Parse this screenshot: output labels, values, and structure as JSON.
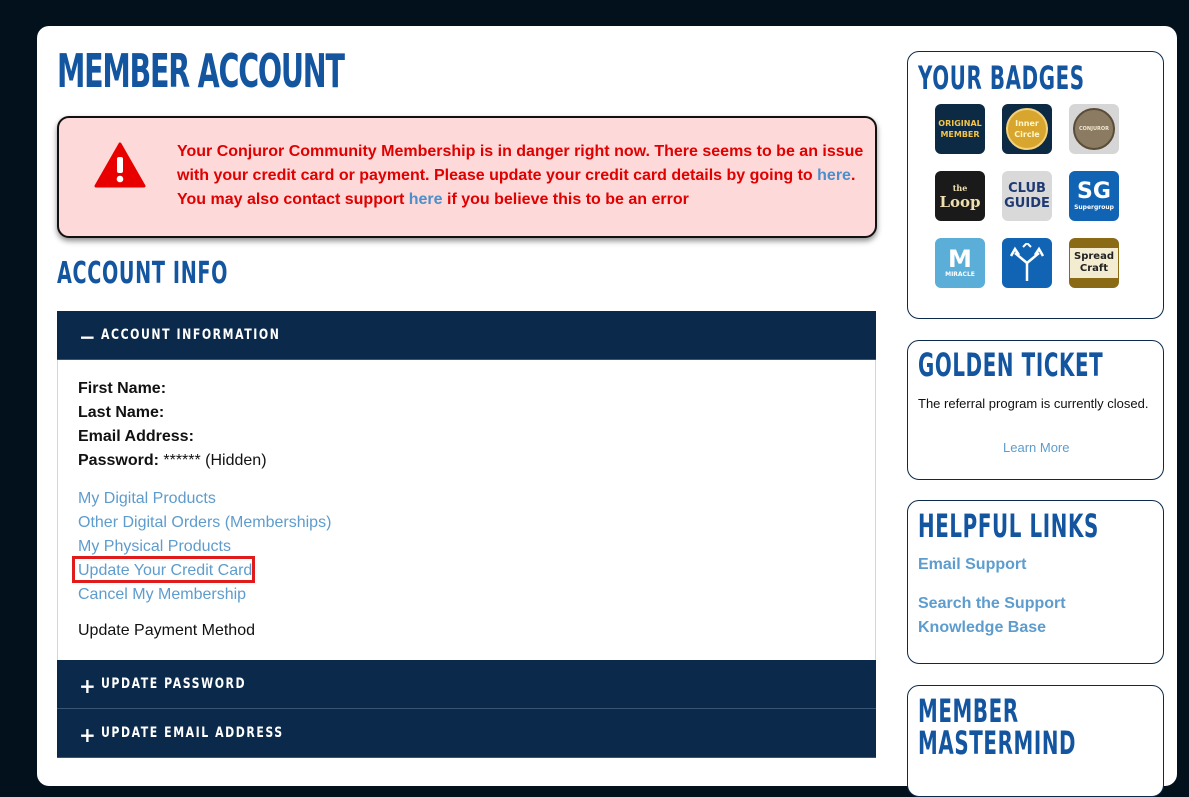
{
  "page": {
    "title": "MEMBER ACCOUNT"
  },
  "alert": {
    "line1": "Your Conjuror Community Membership is in danger right now. There seems to be an issue",
    "line2a": "with your credit card or payment. Please update your credit card details by going to ",
    "line2_link": "here",
    "line2b": ".",
    "line3a": "You may also contact support ",
    "line3_link": "here",
    "line3b": " if you believe this to be an error"
  },
  "account_info": {
    "heading": "ACCOUNT INFO",
    "section_label": "ACCOUNT INFORMATION",
    "fields": {
      "first_name_label": "First Name:",
      "last_name_label": "Last Name:",
      "email_label": "Email Address:",
      "password_label": "Password:",
      "password_value": " ****** (Hidden)"
    },
    "links": [
      "My Digital Products",
      "Other Digital Orders (Memberships)",
      "My Physical Products",
      "Update Your Credit Card",
      "Cancel My Membership"
    ],
    "update_payment_method": "Update Payment Method",
    "update_password_label": "UPDATE PASSWORD",
    "update_email_label": "UPDATE EMAIL ADDRESS"
  },
  "sidebar": {
    "badges": {
      "title": "YOUR BADGES",
      "items": [
        {
          "text1": "ORIGINAL",
          "text2": "MEMBER"
        },
        {
          "text1": "Inner",
          "text2": "Circle"
        },
        {
          "text1": "CONJUROR",
          "text2": ""
        },
        {
          "text1": "the",
          "text2": "Loop"
        },
        {
          "text1": "CLUB",
          "text2": "GUIDE"
        },
        {
          "text1": "SG",
          "text2": "Supergroup"
        },
        {
          "text1": "M",
          "text2": "MIRACLE"
        },
        {
          "text1": "",
          "text2": ""
        },
        {
          "text1": "Spread",
          "text2": "Craft"
        }
      ]
    },
    "golden_ticket": {
      "title": "GOLDEN TICKET",
      "text": "The referral program is currently closed.",
      "link": "Learn More"
    },
    "helpful_links": {
      "title": "HELPFUL LINKS",
      "email_support": "Email Support",
      "search_kb": "Search the Support Knowledge Base"
    },
    "member_mastermind": {
      "title_line1": "MEMBER",
      "title_line2": "MASTERMIND"
    }
  },
  "colors": {
    "background": "#03111d",
    "heading_blue": "#1455a0",
    "link_blue": "#5d9ccd",
    "accordion_navy": "#0b2a4b",
    "alert_red": "#e00000",
    "alert_bg": "#fdd9d9",
    "highlight_red": "#e01b1b"
  }
}
